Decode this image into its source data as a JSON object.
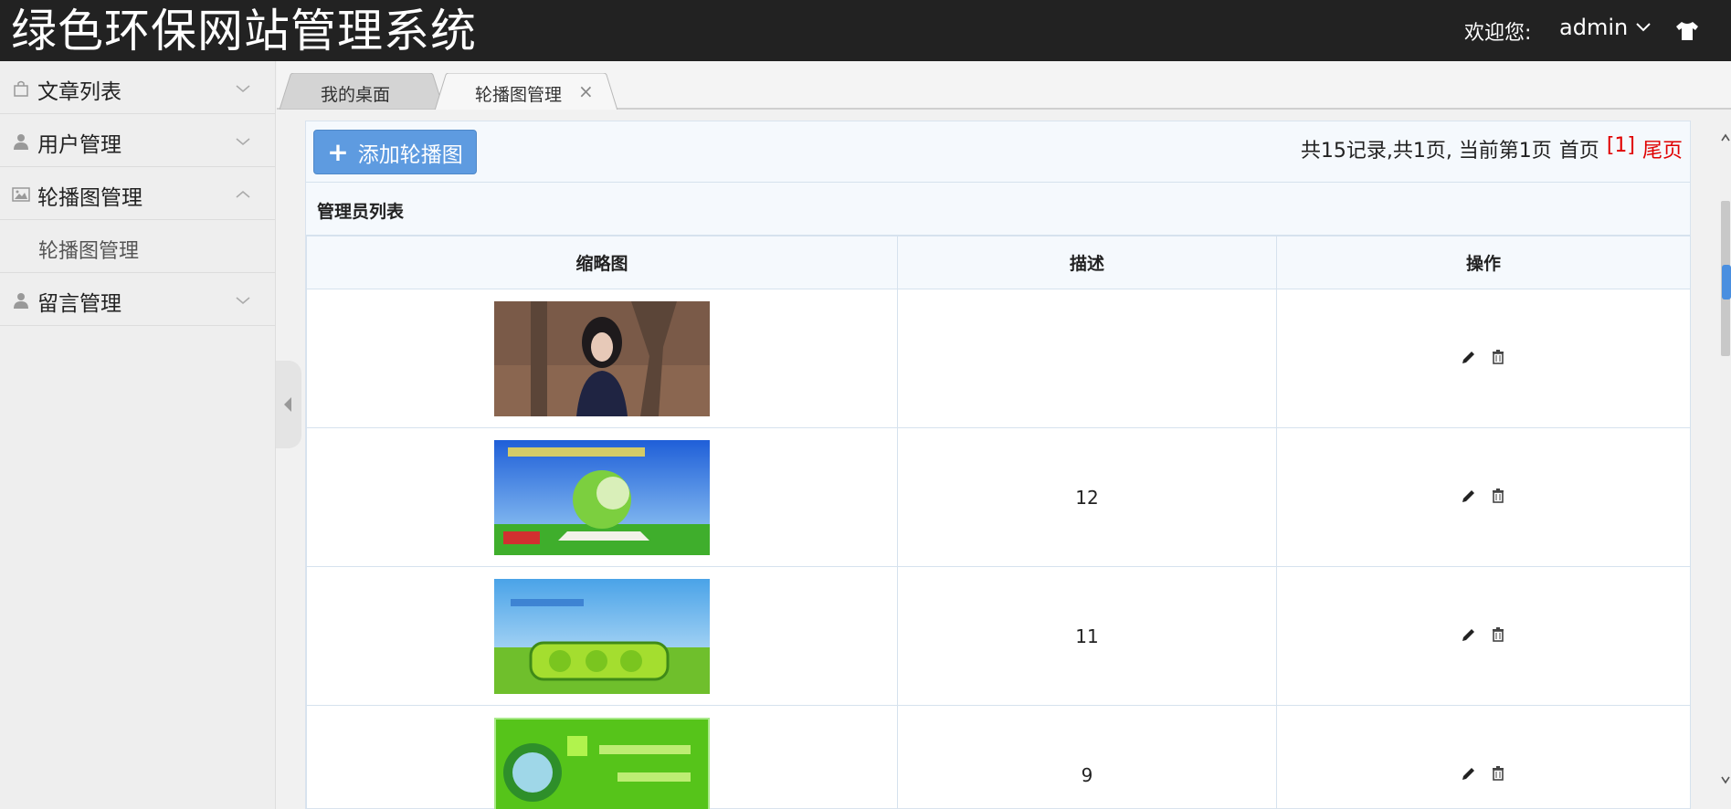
{
  "app": {
    "title": "绿色环保网站管理系统"
  },
  "header": {
    "welcome": "欢迎您:",
    "username": "admin",
    "skin_icon": "shirt-icon"
  },
  "sidebar": {
    "items": [
      {
        "label": "文章列表",
        "icon": "bag-icon",
        "expanded": false
      },
      {
        "label": "用户管理",
        "icon": "user-icon",
        "expanded": false
      },
      {
        "label": "轮播图管理",
        "icon": "image-icon",
        "expanded": true,
        "children": [
          {
            "label": "轮播图管理"
          }
        ]
      },
      {
        "label": "留言管理",
        "icon": "user-icon",
        "expanded": false
      }
    ]
  },
  "tabs": [
    {
      "label": "我的桌面",
      "active": false
    },
    {
      "label": "轮播图管理",
      "active": true,
      "close": "×"
    }
  ],
  "toolbar": {
    "add_label": "添加轮播图",
    "add_icon": "+",
    "pager": {
      "summary": "共15记录,共1页, 当前第1页",
      "first": "首页",
      "current": "[1]",
      "last": "尾页"
    }
  },
  "list": {
    "title": "管理员列表",
    "columns": [
      "缩略图",
      "描述",
      "操作"
    ],
    "rows": [
      {
        "thumbnail": "portrait-photo",
        "description": ""
      },
      {
        "thumbnail": "green-globe-banner",
        "description": "12"
      },
      {
        "thumbnail": "love-banner",
        "description": "11"
      },
      {
        "thumbnail": "recycling-banner",
        "description": "9"
      }
    ]
  },
  "colors": {
    "header_bg": "#222222",
    "primary": "#5e9be0",
    "pager_red": "#e00000"
  }
}
